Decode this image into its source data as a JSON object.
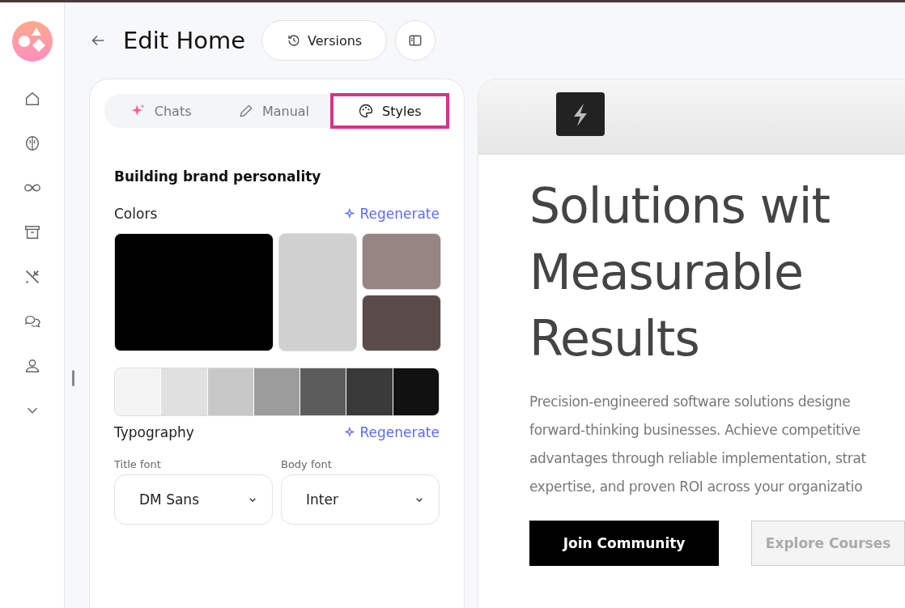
{
  "header": {
    "title": "Edit Home",
    "versions_button": "Versions"
  },
  "tabs": [
    {
      "label": "Chats",
      "kind": "sparkle",
      "selected": false
    },
    {
      "label": "Manual",
      "kind": "pencil",
      "selected": false
    },
    {
      "label": "Styles",
      "kind": "palette",
      "selected": true
    }
  ],
  "styles_panel": {
    "heading": "Building brand personality",
    "colors": {
      "label": "Colors",
      "action": "Regenerate",
      "swatches": [
        {
          "color": "#000000"
        },
        {
          "color": "#d0d0d0"
        },
        {
          "color": "#978583"
        },
        {
          "color": "#5b4b4a"
        }
      ],
      "scale": [
        {
          "color": "#f4f4f4"
        },
        {
          "color": "#e0e0e0"
        },
        {
          "color": "#c8c8c8"
        },
        {
          "color": "#9c9c9c"
        },
        {
          "color": "#5c5c5c"
        },
        {
          "color": "#3a3a3a"
        },
        {
          "color": "#111111"
        }
      ]
    },
    "typography": {
      "label": "Typography",
      "action": "Regenerate",
      "fields": [
        {
          "label": "Title font",
          "value": "DM Sans"
        },
        {
          "label": "Body font",
          "value": "Inter"
        }
      ]
    }
  },
  "preview": {
    "headline_lines": [
      "Solutions wit",
      "Measurable",
      "Results"
    ],
    "paragraph_lines": [
      "Precision-engineered software solutions designe",
      "forward-thinking businesses. Achieve competitive",
      "advantages through reliable implementation, strat",
      "expertise, and proven ROI across your organizatio"
    ],
    "buttons": [
      {
        "label": "Join Community",
        "kind": "primary"
      },
      {
        "label": "Explore Courses",
        "kind": "secondary"
      }
    ]
  }
}
